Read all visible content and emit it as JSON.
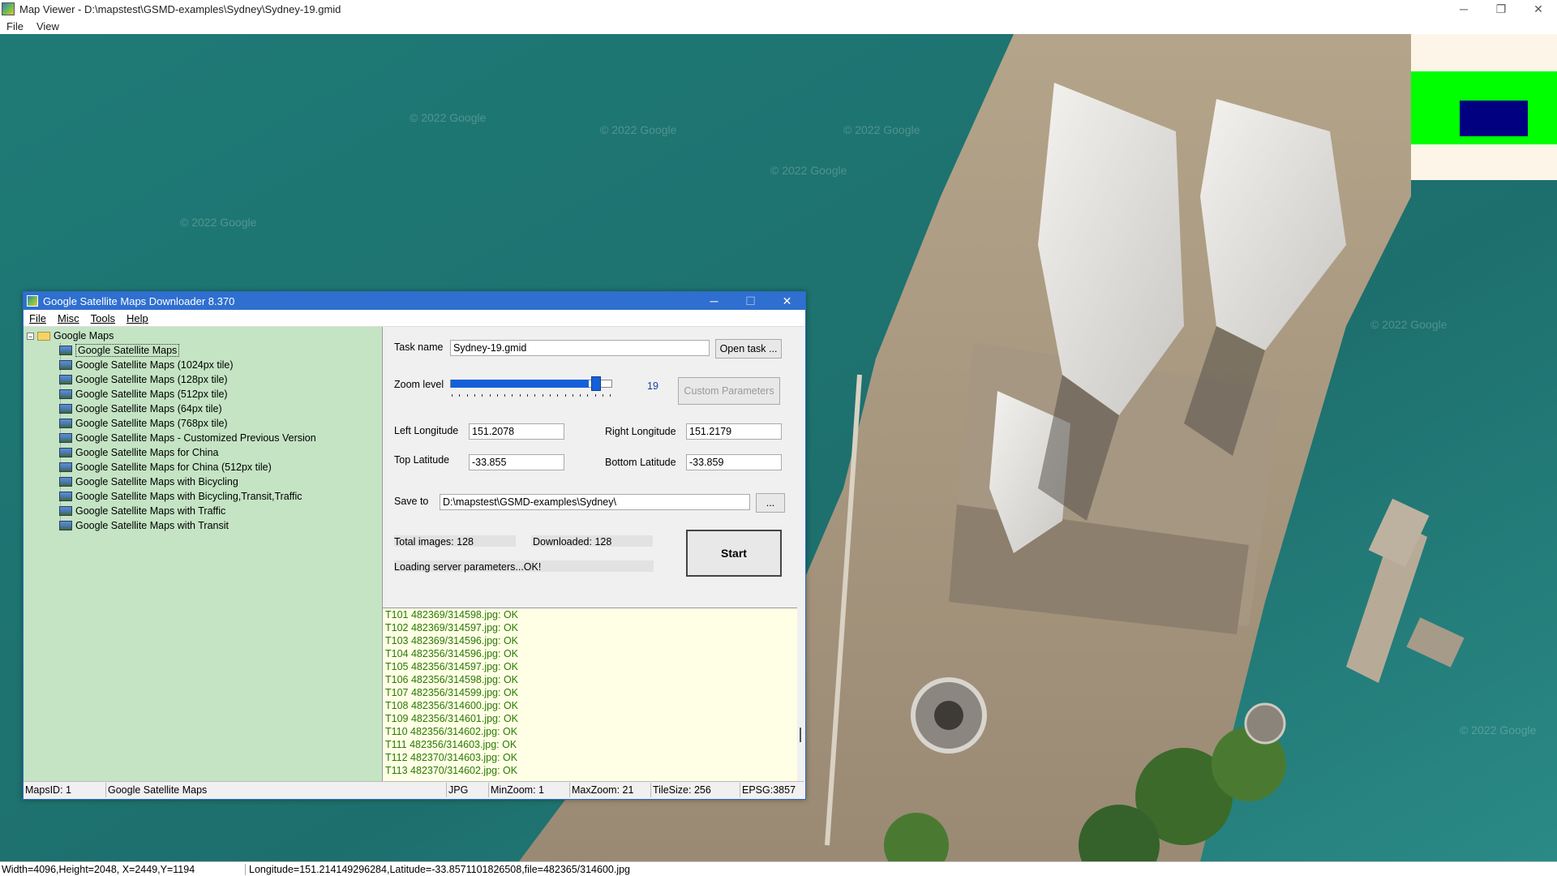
{
  "window": {
    "title": "Map Viewer - D:\\mapstest\\GSMD-examples\\Sydney\\Sydney-19.gmid",
    "menu": [
      "File",
      "View"
    ],
    "controls": {
      "minimize": "─",
      "restore": "❐",
      "close": "✕"
    }
  },
  "map": {
    "watermark": "© 2022 Google"
  },
  "statusbar": {
    "left": "Width=4096,Height=2048, X=2449,Y=1194",
    "right": "Longitude=151.214149296284,Latitude=-33.8571101826508,file=482365/314600.jpg"
  },
  "dialog": {
    "title": "Google Satellite Maps Downloader 8.370",
    "controls": {
      "minimize": "─",
      "maximize": "☐",
      "close": "✕"
    },
    "menu": [
      "File",
      "Misc",
      "Tools",
      "Help"
    ],
    "tree": {
      "root": "Google Maps",
      "items": [
        "Google Satellite Maps",
        "Google Satellite Maps (1024px tile)",
        "Google Satellite Maps (128px tile)",
        "Google Satellite Maps (512px tile)",
        "Google Satellite Maps (64px tile)",
        "Google Satellite Maps (768px tile)",
        "Google Satellite Maps - Customized Previous Version",
        "Google Satellite Maps for China",
        "Google Satellite Maps for China (512px tile)",
        "Google Satellite Maps with Bicycling",
        "Google Satellite Maps with Bicycling,Transit,Traffic",
        "Google Satellite Maps with Traffic",
        "Google Satellite Maps with Transit"
      ],
      "selected_index": 0
    },
    "form": {
      "task_name_label": "Task name",
      "task_name_value": "Sydney-19.gmid",
      "open_task_button": "Open task ...",
      "zoom_label": "Zoom level",
      "zoom_value": "19",
      "zoom_fraction": 0.9,
      "custom_params_button": "Custom Parameters",
      "left_lon_label": "Left Longitude",
      "left_lon_value": "151.2078",
      "right_lon_label": "Right Longitude",
      "right_lon_value": "151.2179",
      "top_lat_label": "Top Latitude",
      "top_lat_value": "-33.855",
      "bottom_lat_label": "Bottom Latitude",
      "bottom_lat_value": "-33.859",
      "save_to_label": "Save to",
      "save_to_value": "D:\\mapstest\\GSMD-examples\\Sydney\\",
      "browse_button": "...",
      "total_images": "Total images: 128",
      "downloaded": "Downloaded: 128",
      "status_text": "Loading server parameters...OK!",
      "start_button": "Start"
    },
    "log": [
      "T101 482369/314598.jpg: OK",
      "T102 482369/314597.jpg: OK",
      "T103 482369/314596.jpg: OK",
      "T104 482356/314596.jpg: OK",
      "T105 482356/314597.jpg: OK",
      "T106 482356/314598.jpg: OK",
      "T107 482356/314599.jpg: OK",
      "T108 482356/314600.jpg: OK",
      "T109 482356/314601.jpg: OK",
      "T110 482356/314602.jpg: OK",
      "T111 482356/314603.jpg: OK",
      "T112 482370/314603.jpg: OK",
      "T113 482370/314602.jpg: OK"
    ],
    "status": {
      "maps_id": "MapsID: 1",
      "map_name": "Google Satellite Maps",
      "format": "JPG",
      "min_zoom": "MinZoom: 1",
      "max_zoom": "MaxZoom: 21",
      "tile_size": "TileSize: 256",
      "epsg": "EPSG:3857"
    }
  }
}
